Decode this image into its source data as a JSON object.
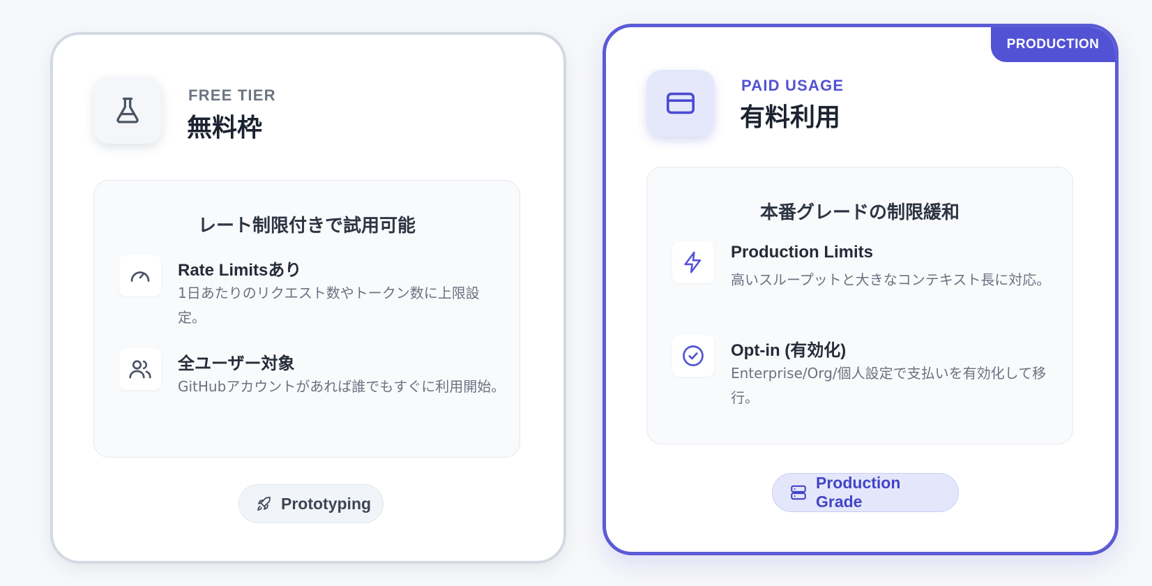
{
  "free": {
    "eyebrow": "FREE TIER",
    "title": "無料枠",
    "icon": "flask-icon",
    "panel_title": "レート制限付きで試用可能",
    "features": [
      {
        "icon": "gauge-icon",
        "title": "Rate Limitsあり",
        "desc": "1日あたりのリクエスト数やトークン数に上限設定。"
      },
      {
        "icon": "users-icon",
        "title": "全ユーザー対象",
        "desc": "GitHubアカウントがあれば誰でもすぐに利用開始。"
      }
    ],
    "pill": {
      "icon": "rocket-icon",
      "label": "Prototyping"
    }
  },
  "paid": {
    "ribbon": "PRODUCTION",
    "eyebrow": "PAID USAGE",
    "title": "有料利用",
    "icon": "credit-card-icon",
    "panel_title": "本番グレードの制限緩和",
    "features": [
      {
        "icon": "lightning-icon",
        "title": "Production Limits",
        "desc": "高いスループットと大きなコンテキスト長に対応。"
      },
      {
        "icon": "check-circle-icon",
        "title": "Opt-in (有効化)",
        "desc": "Enterprise/Org/個人設定で支払いを有効化して移行。"
      }
    ],
    "pill": {
      "icon": "server-icon",
      "label": "Production Grade"
    }
  },
  "colors": {
    "accent": "#5152d4",
    "free_border": "#d3d9e3",
    "text_muted": "#6b7280"
  }
}
